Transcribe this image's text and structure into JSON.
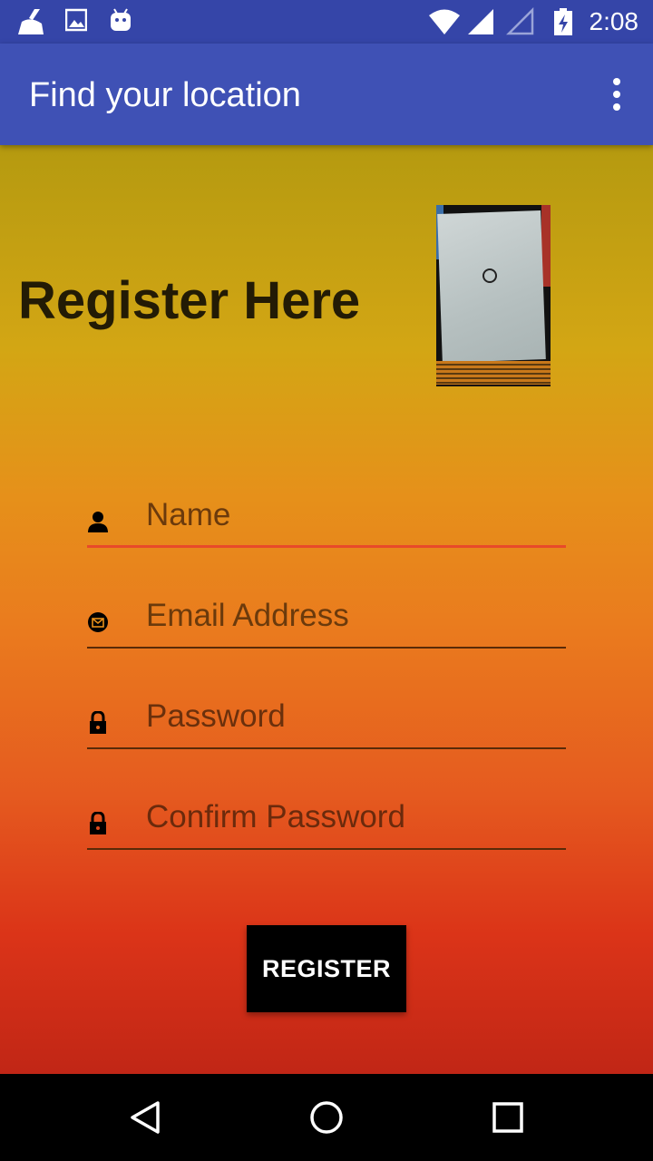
{
  "status_bar": {
    "time": "2:08",
    "icons": [
      "cleaner-icon",
      "gallery-icon",
      "android-icon",
      "wifi-icon",
      "signal-icon",
      "signal-empty-icon",
      "battery-charging-icon"
    ]
  },
  "app_bar": {
    "title": "Find your location",
    "menu_icon": "overflow-menu-icon"
  },
  "main": {
    "heading": "Register Here",
    "photo_icon": "photo-thumbnail",
    "fields": [
      {
        "icon": "person-icon",
        "placeholder": "Name",
        "active": true
      },
      {
        "icon": "email-icon",
        "placeholder": "Email Address",
        "active": false
      },
      {
        "icon": "lock-icon",
        "placeholder": "Password",
        "active": false
      },
      {
        "icon": "lock-icon",
        "placeholder": "Confirm Password",
        "active": false
      }
    ],
    "register_label": "REGISTER"
  },
  "nav_bar": {
    "icons": [
      "back-icon",
      "home-icon",
      "recents-icon"
    ]
  },
  "colors": {
    "app_bar": "#3f51b5",
    "status_bar": "#3545a8",
    "active_underline": "#e84a2a",
    "placeholder_text": "#6b3a0c"
  }
}
